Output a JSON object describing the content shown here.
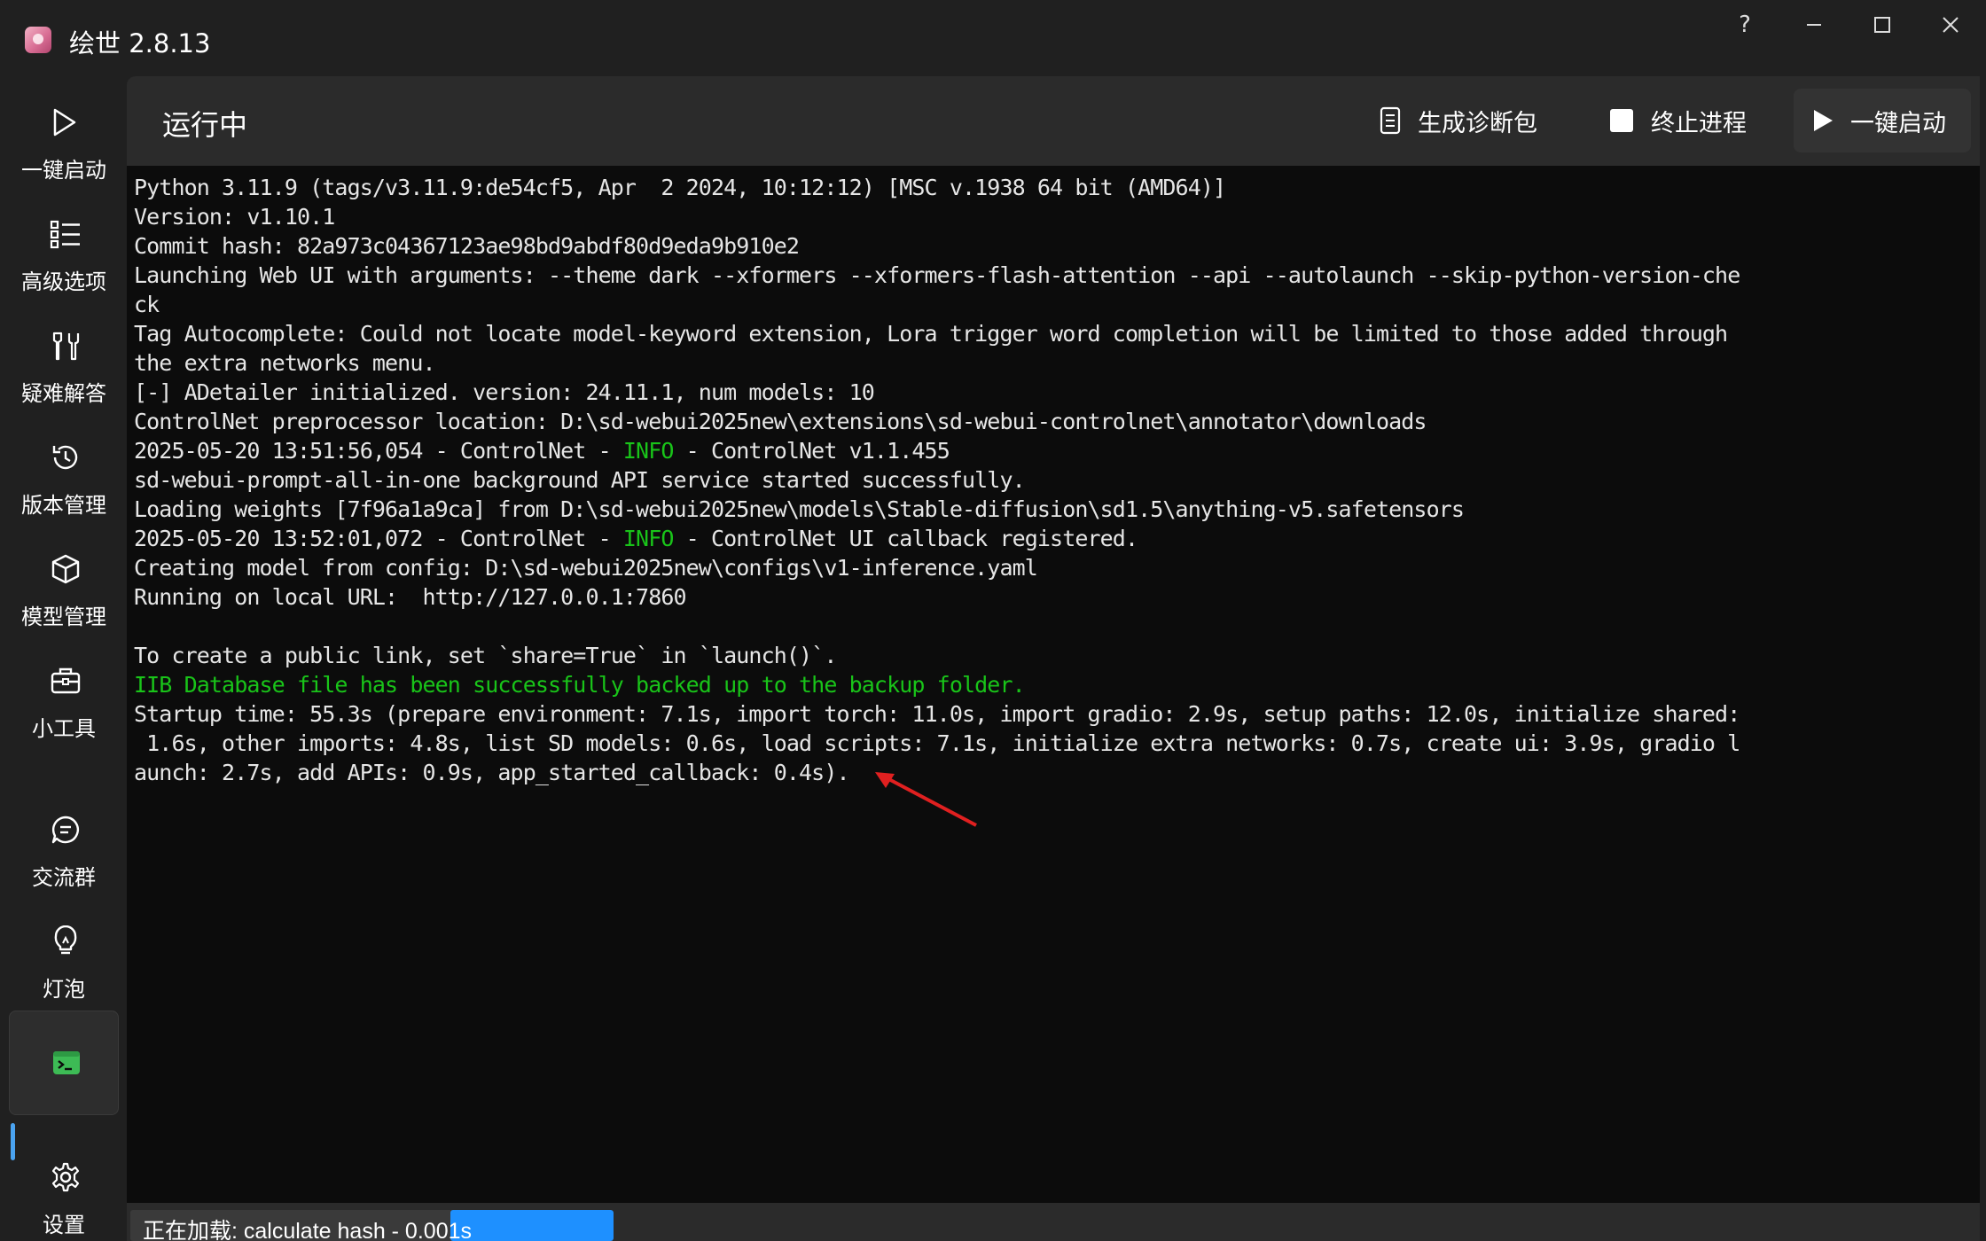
{
  "window": {
    "title": "绘世 2.8.13",
    "help_label": "?"
  },
  "sidebar": {
    "items": [
      {
        "label": "一键启动",
        "icon": "play-icon"
      },
      {
        "label": "高级选项",
        "icon": "list-icon"
      },
      {
        "label": "疑难解答",
        "icon": "wrench-icon"
      },
      {
        "label": "版本管理",
        "icon": "history-icon"
      },
      {
        "label": "模型管理",
        "icon": "cube-icon"
      },
      {
        "label": "小工具",
        "icon": "toolbox-icon"
      },
      {
        "label": "交流群",
        "icon": "chat-icon"
      },
      {
        "label": "灯泡",
        "icon": "bulb-icon"
      },
      {
        "label": "",
        "icon": "terminal-icon",
        "active": true
      },
      {
        "label": "设置",
        "icon": "gear-icon"
      }
    ]
  },
  "header": {
    "title": "运行中",
    "actions": {
      "diagnose": "生成诊断包",
      "stop": "终止进程",
      "launch": "一键启动"
    }
  },
  "console": {
    "lines": [
      "Python 3.11.9 (tags/v3.11.9:de54cf5, Apr  2 2024, 10:12:12) [MSC v.1938 64 bit (AMD64)]",
      "Version: v1.10.1",
      "Commit hash: 82a973c04367123ae98bd9abdf80d9eda9b910e2",
      "Launching Web UI with arguments: --theme dark --xformers --xformers-flash-attention --api --autolaunch --skip-python-version-che",
      "ck",
      "Tag Autocomplete: Could not locate model-keyword extension, Lora trigger word completion will be limited to those added through",
      "the extra networks menu.",
      "[-] ADetailer initialized. version: 24.11.1, num models: 10",
      "ControlNet preprocessor location: D:\\sd-webui2025new\\extensions\\sd-webui-controlnet\\annotator\\downloads",
      "2025-05-20 13:51:56,054 - ControlNet - INFO - ControlNet v1.1.455",
      "sd-webui-prompt-all-in-one background API service started successfully.",
      "Loading weights [7f96a1a9ca] from D:\\sd-webui2025new\\models\\Stable-diffusion\\sd1.5\\anything-v5.safetensors",
      "2025-05-20 13:52:01,072 - ControlNet - INFO - ControlNet UI callback registered.",
      "Creating model from config: D:\\sd-webui2025new\\configs\\v1-inference.yaml",
      "Running on local URL:  http://127.0.0.1:7860",
      "",
      "To create a public link, set `share=True` in `launch()`.",
      "IIB Database file has been successfully backed up to the backup folder.",
      "Startup time: 55.3s (prepare environment: 7.1s, import torch: 11.0s, import gradio: 2.9s, setup paths: 12.0s, initialize shared:",
      " 1.6s, other imports: 4.8s, list SD models: 0.6s, load scripts: 7.1s, initialize extra networks: 0.7s, create ui: 3.9s, gradio l",
      "aunch: 2.7s, add APIs: 0.9s, app_started_callback: 0.4s)."
    ],
    "green_lines": [
      17
    ],
    "green_word": "INFO",
    "colors": {
      "text": "#e6e6e6",
      "green": "#19c419",
      "background": "#0c0c0c"
    }
  },
  "status": {
    "loading_text": "正在加载: calculate hash - 0.001s",
    "progress_fraction": 0.75
  },
  "colors": {
    "accent": "#4aa3f0",
    "progress": "#1e90ff",
    "annotation_arrow": "#e02020"
  }
}
